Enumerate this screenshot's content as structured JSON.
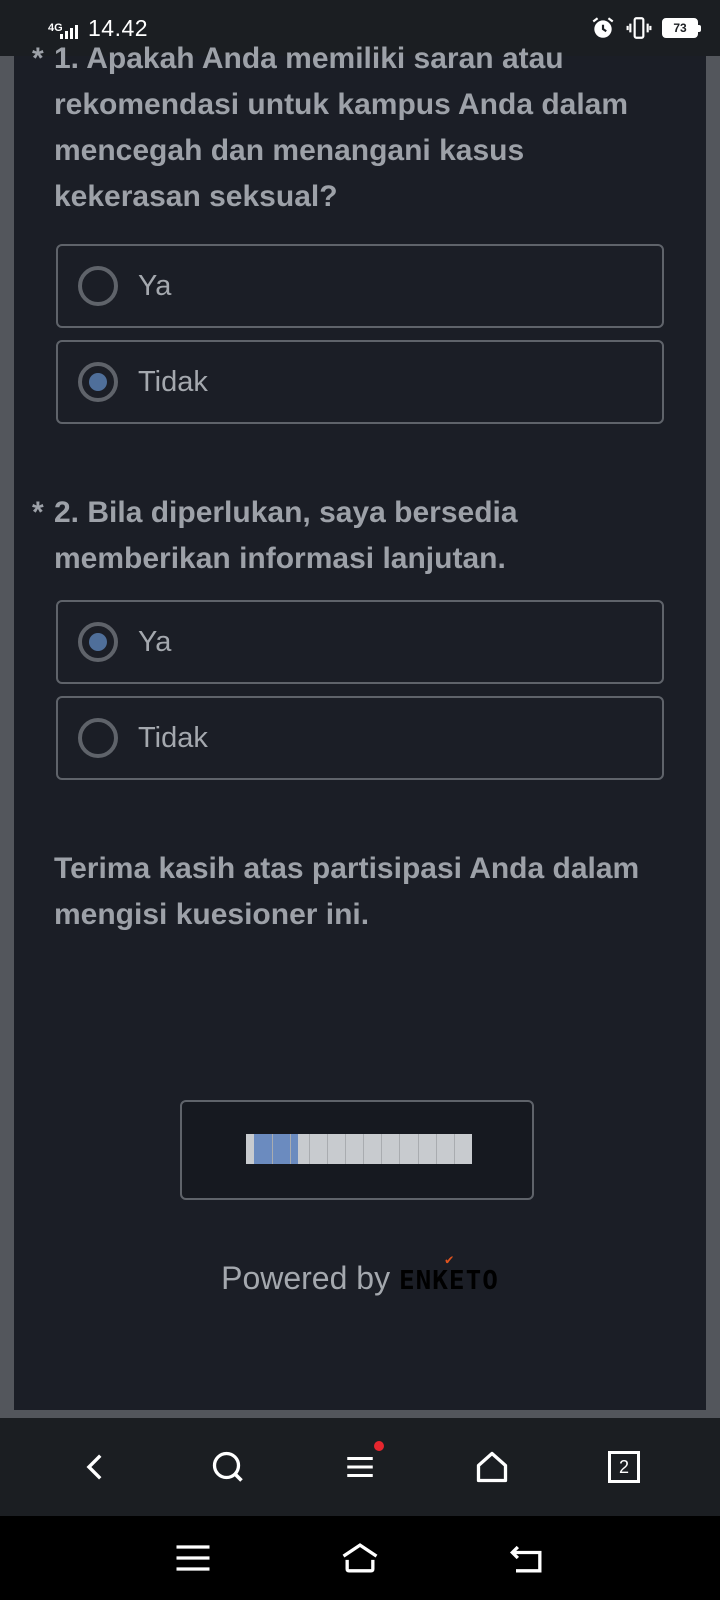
{
  "status_bar": {
    "network": "4G",
    "time": "14.42",
    "battery": "73",
    "icons": [
      "signal-icon",
      "alarm-icon",
      "vibrate-icon",
      "battery-icon"
    ]
  },
  "form": {
    "question1": {
      "required_marker": "*",
      "text": "1. Apakah Anda memiliki saran atau rekomendasi untuk kampus Anda dalam mencegah dan menangani kasus kekerasan seksual?",
      "options": [
        {
          "label": "Ya",
          "selected": false
        },
        {
          "label": "Tidak",
          "selected": true
        }
      ]
    },
    "question2": {
      "required_marker": "*",
      "text": "2. Bila diperlukan, saya bersedia memberikan informasi lanjutan.",
      "options": [
        {
          "label": "Ya",
          "selected": true
        },
        {
          "label": "Tidak",
          "selected": false
        }
      ]
    },
    "thanks": "Terima kasih atas partisipasi Anda dalam mengisi kuesioner ini.",
    "progress": 0.2,
    "progress_segments": 12,
    "powered_by": "Powered by",
    "brand": "ENKETO"
  },
  "colors": {
    "background": "#53565c",
    "card": "#1b1e26",
    "text": "#9da1a8",
    "radio_selected": "#4f6f9a",
    "progress_fill": "#6b8bbf",
    "brand_tick": "#e0531e",
    "notification_dot": "#e5262e"
  },
  "browser_toolbar": {
    "icons": [
      "back-icon",
      "search-icon",
      "menu-icon",
      "home-icon",
      "tabs-icon"
    ],
    "tab_count": "2"
  },
  "system_nav": {
    "icons": [
      "recents-icon",
      "home-icon",
      "back-icon"
    ]
  }
}
